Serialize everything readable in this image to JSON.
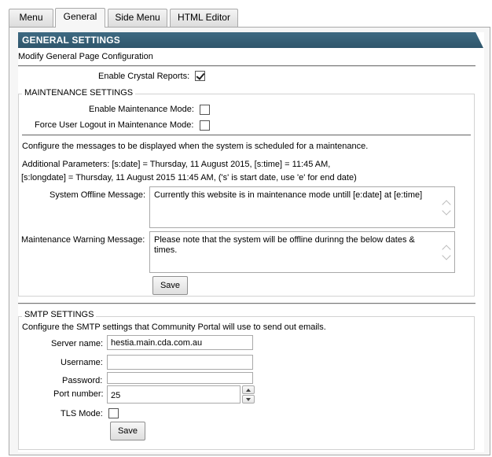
{
  "tabs": [
    {
      "label": "Menu"
    },
    {
      "label": "General"
    },
    {
      "label": "Side Menu"
    },
    {
      "label": "HTML Editor"
    }
  ],
  "active_tab": "General",
  "general": {
    "title": "GENERAL SETTINGS",
    "subtitle": "Modify General Page Configuration",
    "crystal_reports_label": "Enable Crystal Reports:",
    "crystal_reports_checked": true
  },
  "maintenance": {
    "legend": "MAINTENANCE SETTINGS",
    "enable_label": "Enable Maintenance Mode:",
    "enable_checked": false,
    "force_logout_label": "Force User Logout in Maintenance Mode:",
    "force_logout_checked": false,
    "intro": "Configure the messages to be displayed when the system is scheduled for a maintenance.",
    "params_line1": "Additional Parameters: [s:date] = Thursday, 11 August 2015, [s:time] = 11:45 AM,",
    "params_line2": "[s:longdate] = Thursday, 11 August 2015 11:45 AM, ('s' is start date, use 'e' for end date)",
    "offline_label": "System Offline Message:",
    "offline_value": "Currently this website is in maintenance mode untill [e:date] at [e:time]",
    "warning_label": "Maintenance Warning Message:",
    "warning_value": "Please note that the system will be offline durinng the below dates & times.",
    "save_label": "Save"
  },
  "smtp": {
    "legend": "SMTP SETTINGS",
    "intro": "Configure the SMTP settings that Community Portal will use to send out emails.",
    "server_label": "Server name:",
    "server_value": "hestia.main.cda.com.au",
    "username_label": "Username:",
    "username_value": "",
    "password_label": "Password:",
    "password_value": "",
    "port_label": "Port number:",
    "port_value": "25",
    "tls_label": "TLS Mode:",
    "tls_checked": false,
    "save_label": "Save"
  },
  "colors": {
    "banner": "#2f566b",
    "panel_bg": "#f6f6f6"
  }
}
